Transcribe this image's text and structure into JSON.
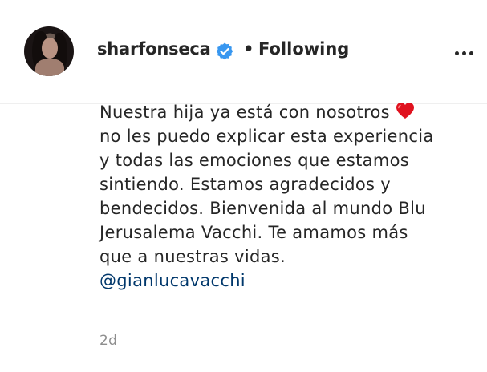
{
  "header": {
    "username": "sharfonseca",
    "separator": "•",
    "follow_status": "Following",
    "verified_icon": "verified-badge-icon",
    "more_icon": "more-options-icon"
  },
  "caption": {
    "lines": [
      "Nuestra hija ya está con nosotros",
      "no les puedo explicar esta experiencia",
      "y todas las emociones que estamos",
      "sintiendo. Estamos agradecidos y",
      "bendecidos. Bienvenida al mundo Blu",
      "Jerusalema Vacchi. Te amamos más",
      "que a nuestras vidas."
    ],
    "emoji": "heart-emoji",
    "mention": "@gianlucavacchi"
  },
  "timestamp": "2d",
  "colors": {
    "text": "#262626",
    "mention": "#00376b",
    "muted": "#8e8e8e",
    "verified": "#3897f0",
    "heart": "#e0121f"
  }
}
